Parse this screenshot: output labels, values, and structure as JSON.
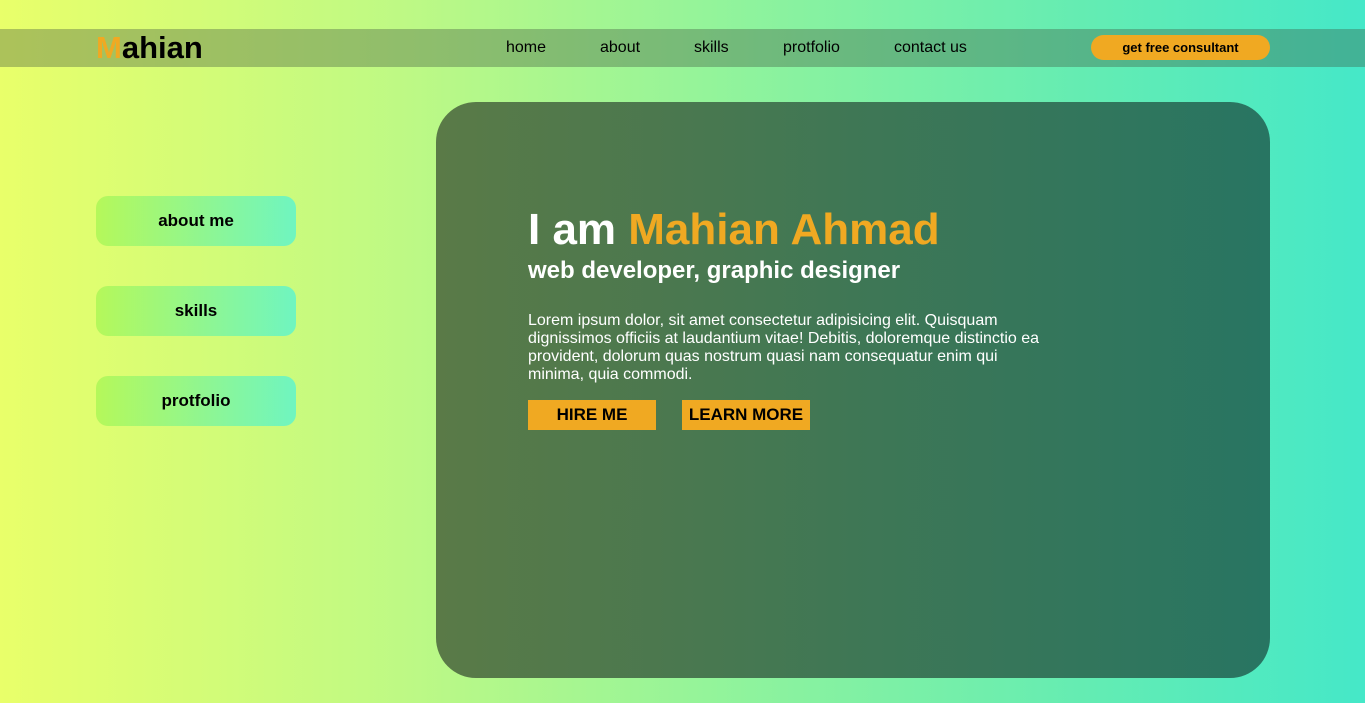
{
  "header": {
    "logo_first_letter": "M",
    "logo_rest": "ahian",
    "nav": [
      {
        "label": "home"
      },
      {
        "label": "about"
      },
      {
        "label": "skills"
      },
      {
        "label": "protfolio"
      },
      {
        "label": "contact us"
      }
    ],
    "cta_label": "get free consultant"
  },
  "sidebar": {
    "items": [
      {
        "label": "about me"
      },
      {
        "label": "skills"
      },
      {
        "label": "protfolio"
      }
    ]
  },
  "hero": {
    "title_prefix": "I am ",
    "title_name": "Mahian Ahmad",
    "subtitle": "web developer, graphic designer",
    "description": "Lorem ipsum dolor, sit amet consectetur adipisicing elit. Quisquam dignissimos officiis at laudantium vitae! Debitis, doloremque distinctio ea provident, dolorum quas nostrum quasi nam consequatur enim qui minima, quia commodi.",
    "hire_label": "HIRE ME",
    "learn_label": "LEARN MORE"
  },
  "colors": {
    "accent": "#f0a922",
    "hero_start": "#5a7a47",
    "hero_end": "#287562"
  }
}
